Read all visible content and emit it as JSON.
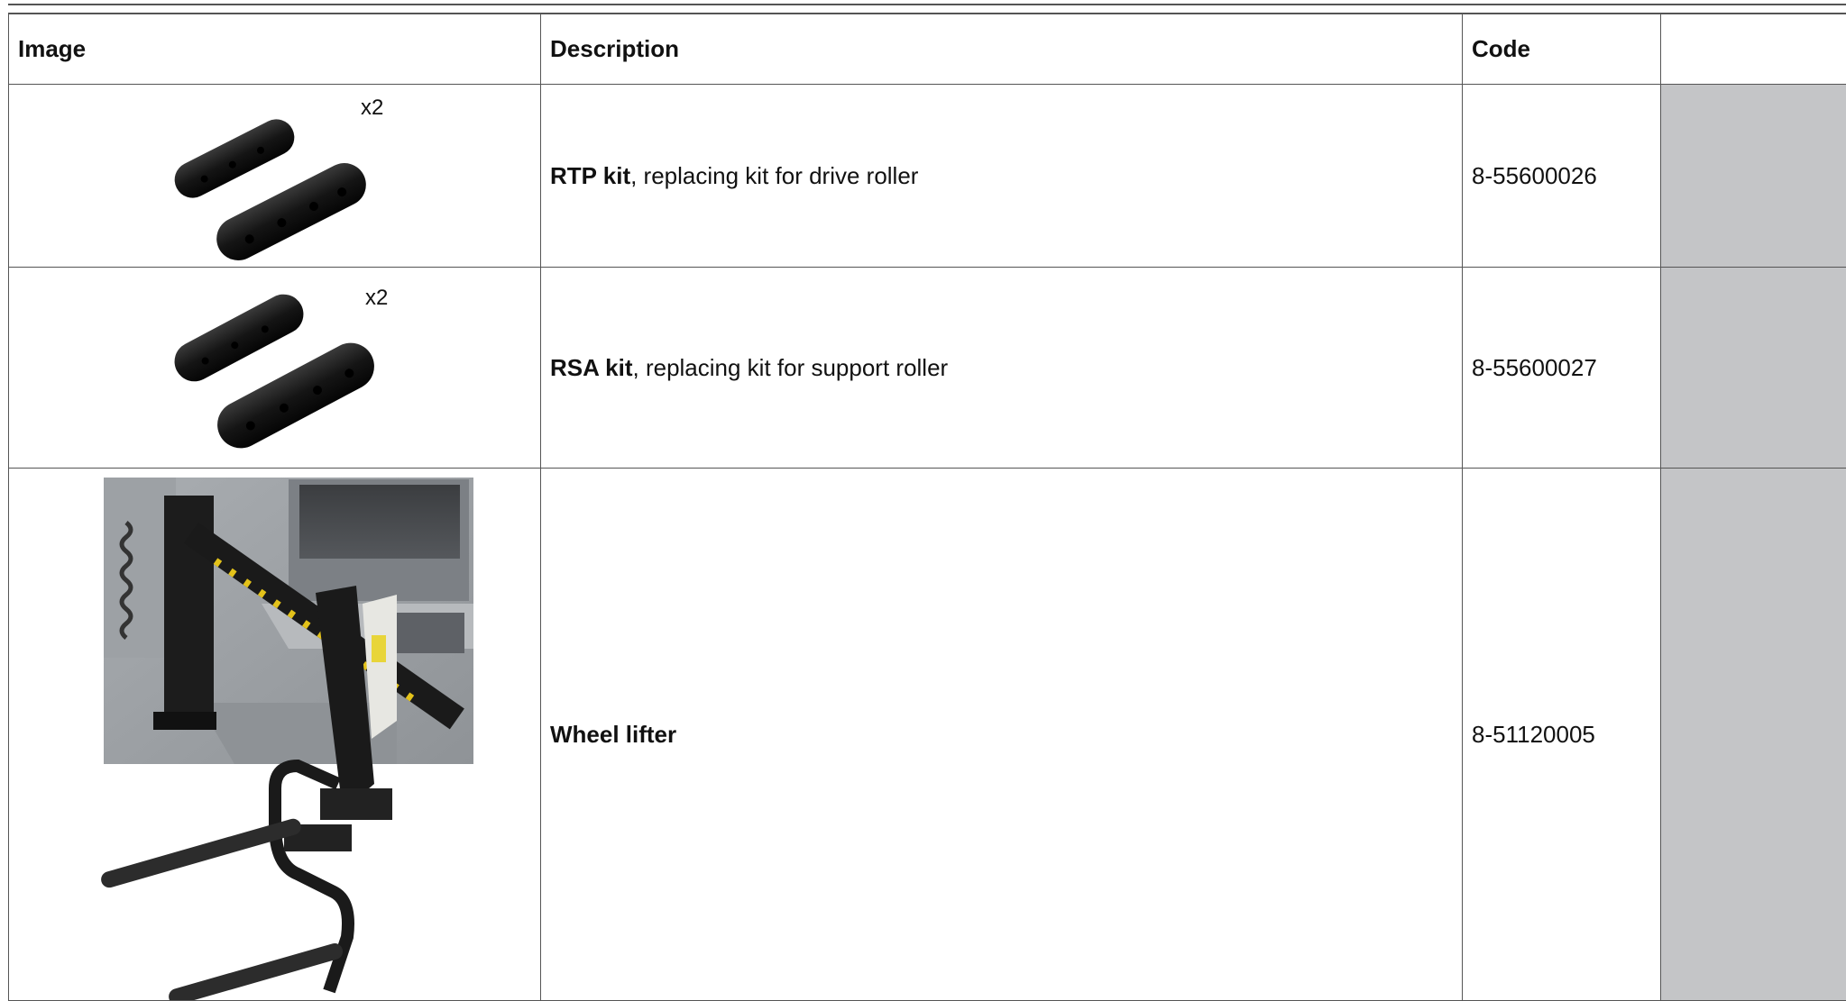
{
  "table": {
    "headers": {
      "image": "Image",
      "description": "Description",
      "code": "Code",
      "extra": ""
    },
    "rows": [
      {
        "name": "RTP kit",
        "description": ", replacing kit for drive roller",
        "code": "8-55600026",
        "quantity": "x2",
        "image": "black-roller-half-shells-icon"
      },
      {
        "name": "RSA kit",
        "description": ", replacing kit for support roller",
        "code": "8-55600027",
        "quantity": "x2",
        "image": "black-roller-half-shells-icon"
      },
      {
        "name": "Wheel lifter",
        "description": "",
        "code": "8-51120005",
        "quantity": "",
        "image": "wheel-lifter-photo"
      }
    ]
  },
  "colors": {
    "grid_line": "#555555",
    "extra_column_fill": "#c4c5c7"
  }
}
